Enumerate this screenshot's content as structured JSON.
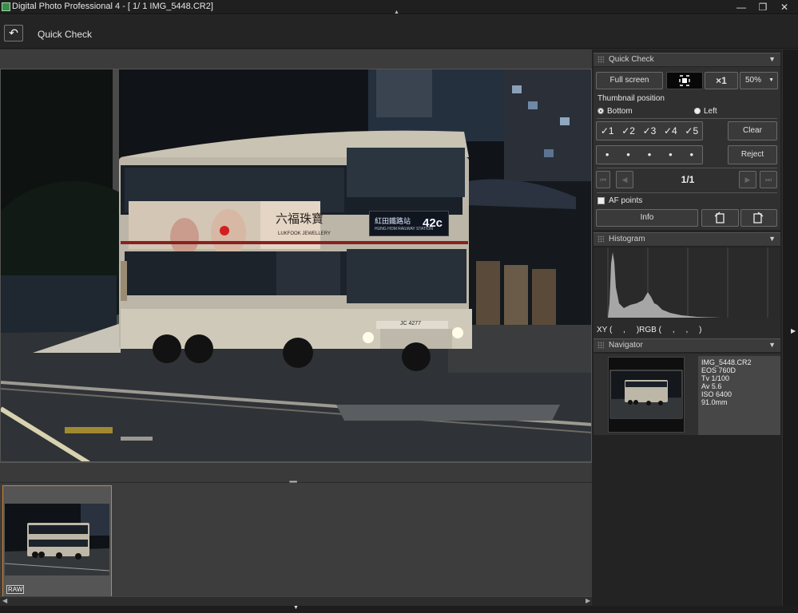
{
  "window": {
    "title": "Digital Photo Professional 4 - [  1/   1 IMG_5448.CR2]",
    "minimize": "—",
    "restore": "❐",
    "close": "✕"
  },
  "toolbar": {
    "back_icon": "↶",
    "label": "Quick Check"
  },
  "preview": {
    "bus_route_display": "紅田鐵路站",
    "bus_route_sub": "HUNG HOM RAILWAY STATION",
    "bus_route_number": "42c",
    "ad_text": "六福珠寶",
    "ad_sub": "LUKFOOK JEWELLERY",
    "plate": "JC 4277"
  },
  "thumbnails": {
    "items": [
      {
        "badge": "RAW"
      }
    ]
  },
  "quick_check": {
    "header": "Quick Check",
    "full_screen": "Full screen",
    "zoom_x1": "×1",
    "zoom_percent": "50%",
    "thumbnail_position_label": "Thumbnail position",
    "bottom_label": "Bottom",
    "left_label": "Left",
    "ratings": [
      "✓1",
      "✓2",
      "✓3",
      "✓4",
      "✓5"
    ],
    "clear": "Clear",
    "stars": [
      "•",
      "•",
      "•",
      "•",
      "•"
    ],
    "reject": "Reject",
    "page_indicator": "1/1",
    "af_points_label": "AF points",
    "info": "Info"
  },
  "histogram": {
    "header": "Histogram",
    "readout": "XY (     ,     )RGB (     ,     ,     )"
  },
  "navigator": {
    "header": "Navigator",
    "filename": "IMG_5448.CR2",
    "camera": "EOS 760D",
    "tv": "Tv 1/100",
    "av": "Av 5.6",
    "iso": "ISO 6400",
    "focal": "91.0mm"
  },
  "colors": {
    "accent_thumb_border": "#c9843a",
    "panel_header": "#3b3b3b",
    "background": "#2b2b2b"
  }
}
